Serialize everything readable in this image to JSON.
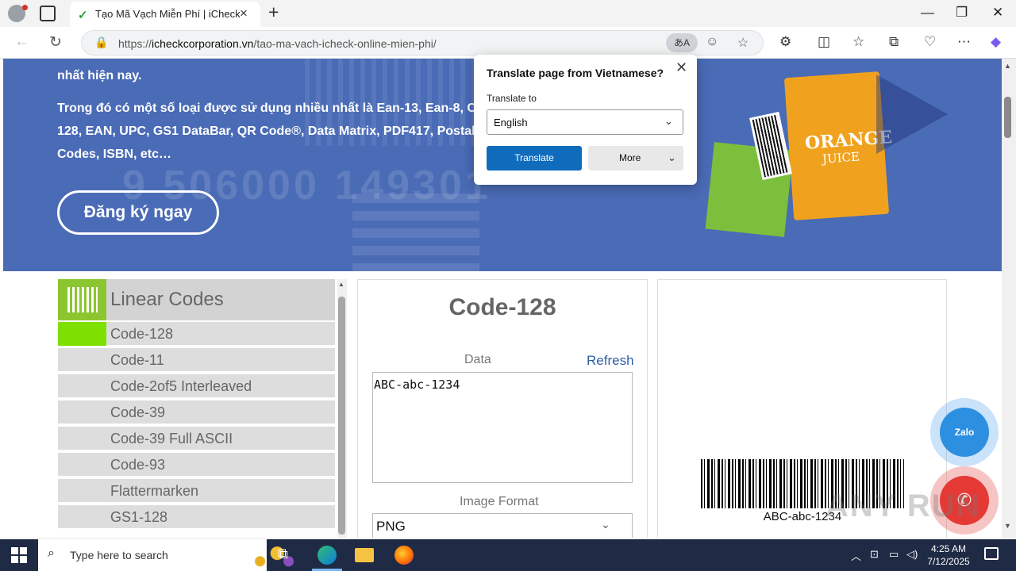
{
  "browser": {
    "tab_title": "Tạo Mã Vạch Miễn Phí | iCheck",
    "url_prefix": "https://",
    "url_domain": "icheckcorporation.vn",
    "url_path": "/tao-ma-vach-icheck-online-mien-phi/"
  },
  "hero": {
    "line_top": "nhất hiện nay.",
    "paragraph_line1": "Trong đó có một số loại được sử dụng nhiều nhất là Ean-13, Ean-8, Co",
    "paragraph_line2": "128, EAN, UPC, GS1 DataBar, QR Code®, Data Matrix, PDF417, Postal",
    "paragraph_line3": "Codes, ISBN, etc…",
    "cta": "Đăng ký ngay",
    "watermark_number": "9 506000 149301",
    "product_label": "ORANGE",
    "product_sublabel": "JUICE"
  },
  "codes": {
    "header": "Linear Codes",
    "items": [
      "Code-128",
      "Code-11",
      "Code-2of5 Interleaved",
      "Code-39",
      "Code-39 Full ASCII",
      "Code-93",
      "Flattermarken",
      "GS1-128"
    ],
    "selected": "Code-128"
  },
  "form": {
    "title": "Code-128",
    "data_label": "Data",
    "refresh": "Refresh",
    "data_value": "ABC-abc-1234",
    "format_label": "Image Format",
    "format_value": "PNG"
  },
  "preview": {
    "barcode_text": "ABC-abc-1234"
  },
  "floating": {
    "zalo": "Zalo",
    "watermark": "ANY RUN"
  },
  "translate_popup": {
    "title": "Translate page from Vietnamese?",
    "to_label": "Translate to",
    "language": "English",
    "translate_button": "Translate",
    "more_button": "More"
  },
  "taskbar": {
    "search_placeholder": "Type here to search",
    "time": "4:25 AM",
    "date": "7/12/2025"
  },
  "colors": {
    "hero_bg": "#4a6bb6",
    "selected_code": "#7ee000",
    "translate_button": "#0f6cbd",
    "link": "#2e5ea5"
  }
}
